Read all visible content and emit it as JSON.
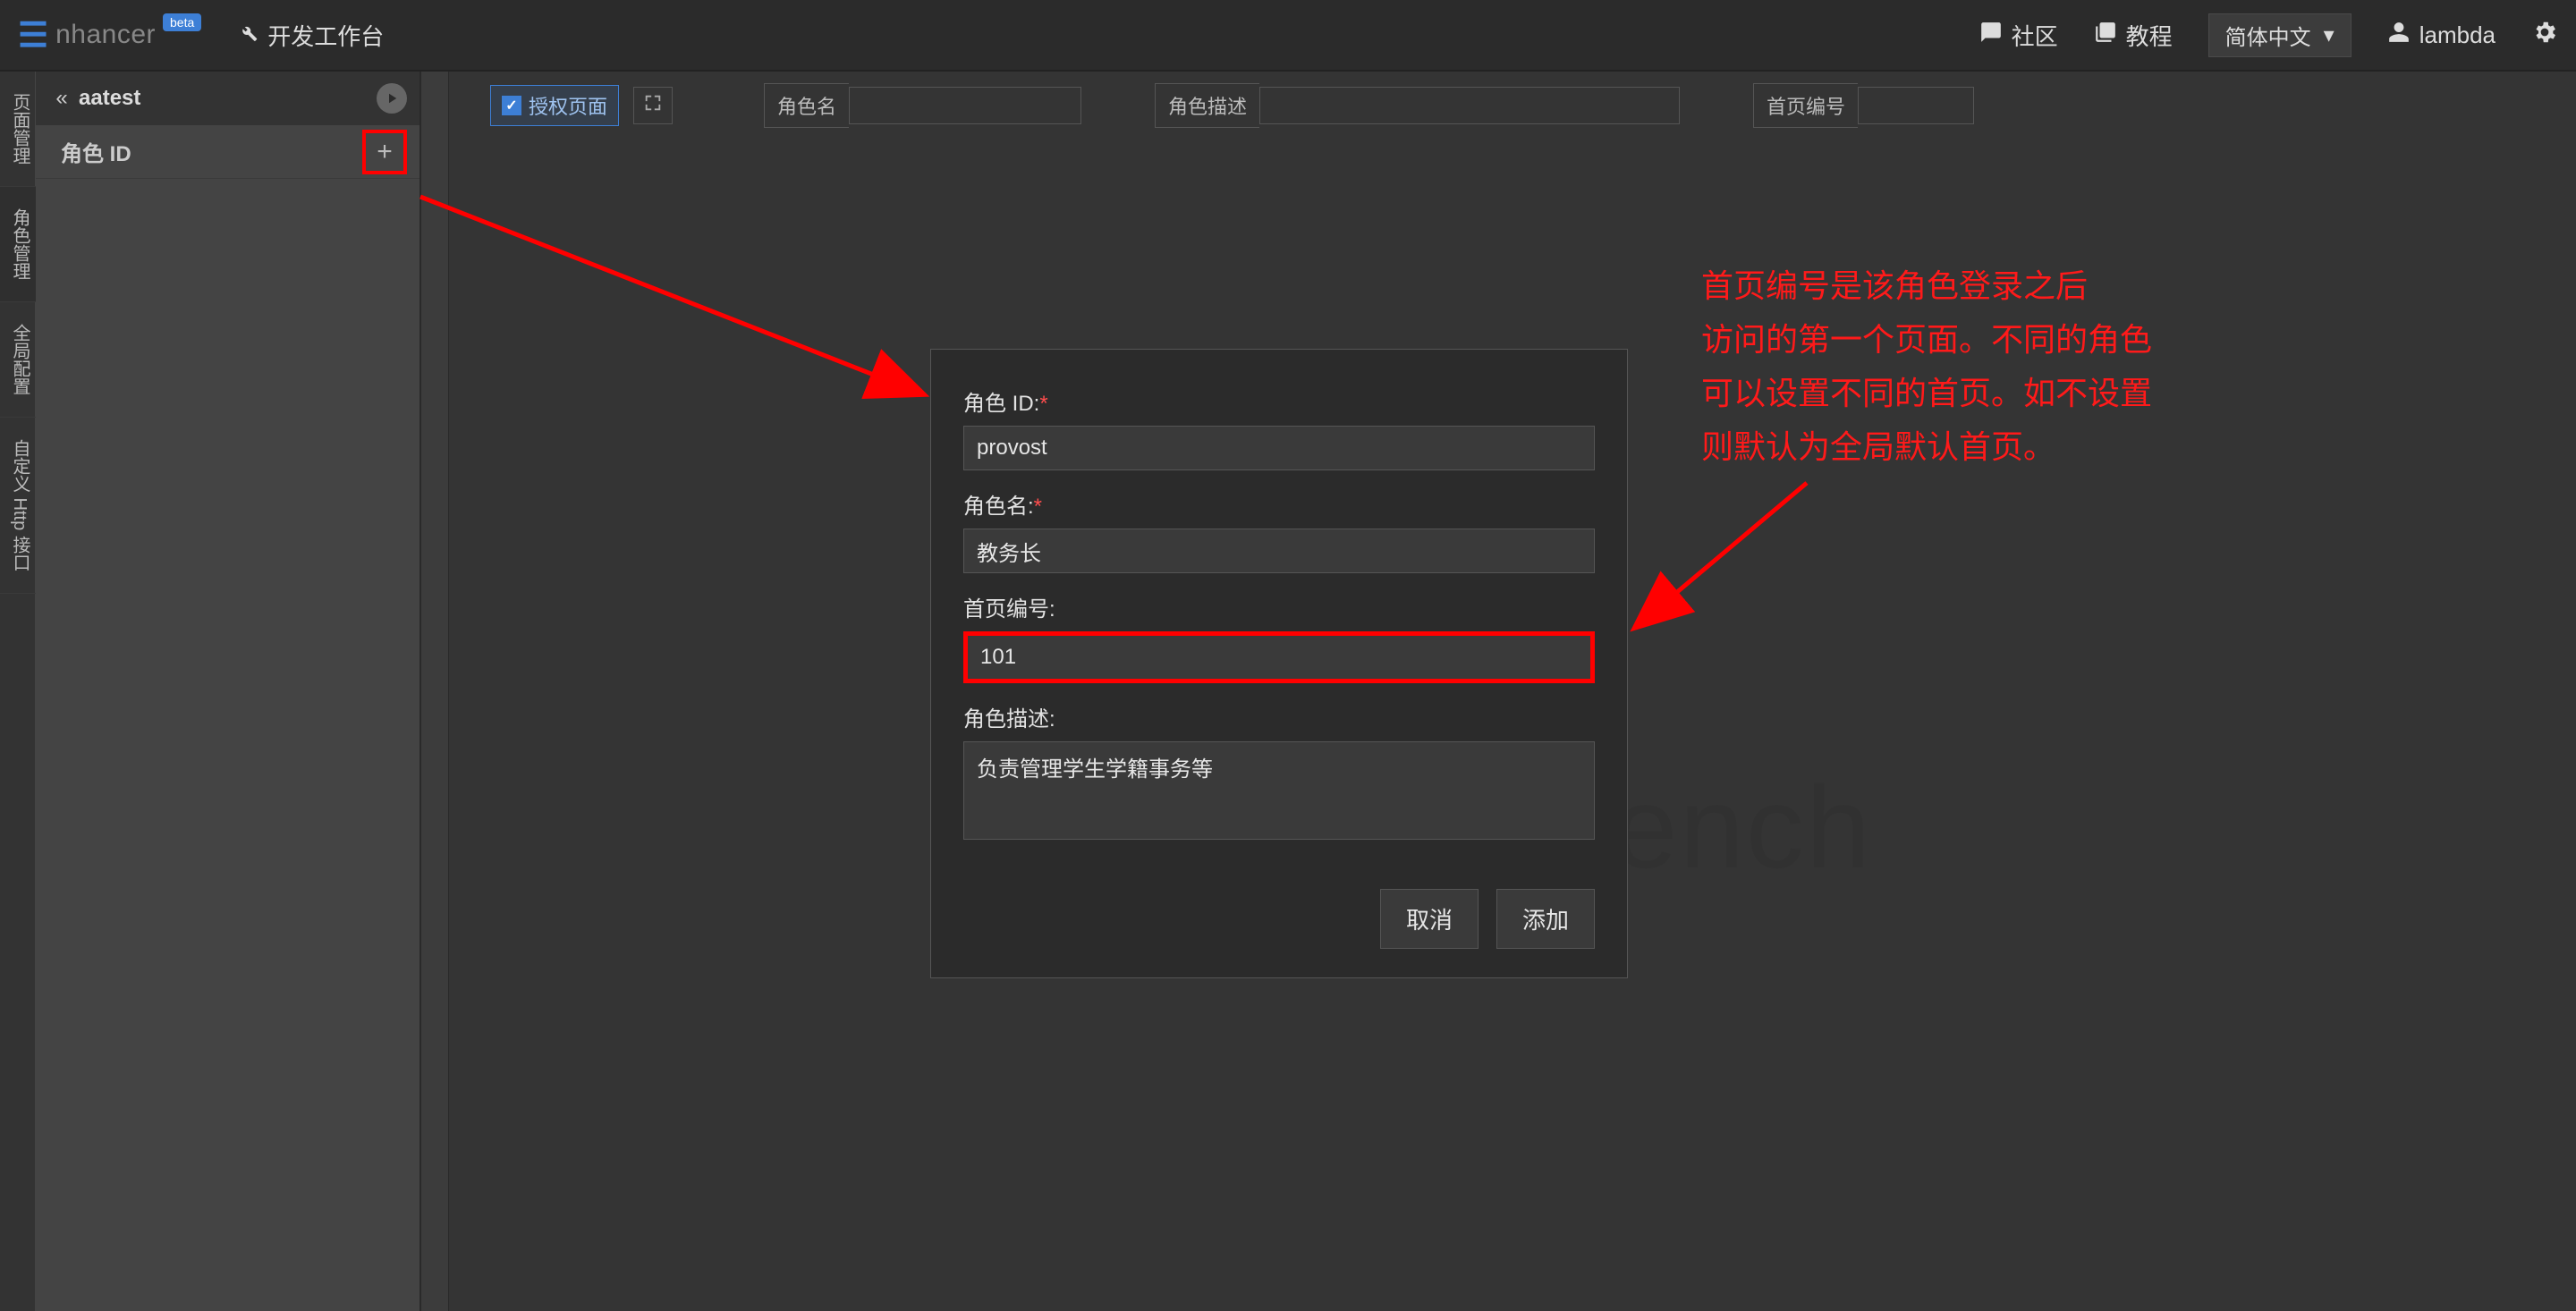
{
  "top": {
    "logo_text": "nhancer",
    "beta": "beta",
    "workbench": "开发工作台",
    "community": "社区",
    "tutorial": "教程",
    "lang": "简体中文",
    "user": "lambda"
  },
  "vrail": {
    "page_mgmt": "页面管理",
    "role_mgmt": "角色管理",
    "global_cfg": "全局配置",
    "http_api": "自定义 Http 接口"
  },
  "sidebar": {
    "project": "aatest",
    "role_id_label": "角色 ID"
  },
  "toolbar": {
    "auth_page": "授权页面",
    "role_name_label": "角色名",
    "role_desc_label": "角色描述",
    "home_no_label": "首页编号"
  },
  "dialog": {
    "role_id_label": "角色 ID:",
    "role_id_value": "provost",
    "role_name_label": "角色名:",
    "role_name_value": "教务长",
    "home_no_label": "首页编号:",
    "home_no_value": "101",
    "role_desc_label": "角色描述:",
    "role_desc_value": "负责管理学生学籍事务等",
    "cancel": "取消",
    "add": "添加"
  },
  "annotation": {
    "l1": "首页编号是该角色登录之后",
    "l2": "访问的第一个页面。不同的角色",
    "l3": "可以设置不同的首页。如不设置",
    "l4": "则默认为全局默认首页。"
  },
  "watermark": "kbench"
}
